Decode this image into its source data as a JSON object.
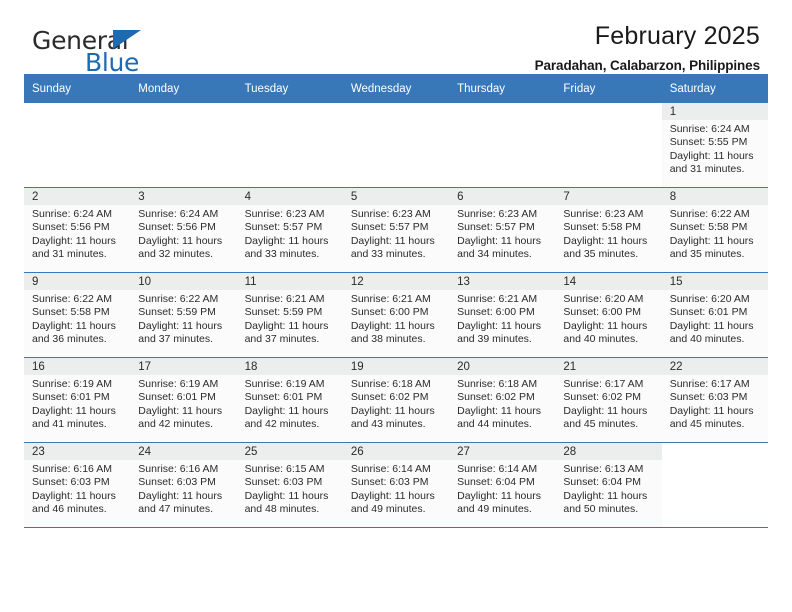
{
  "brand": {
    "line1": "General",
    "line2": "Blue",
    "triangle_color": "#1e69b0"
  },
  "header": {
    "title": "February 2025",
    "subtitle": "Paradahan, Calabarzon, Philippines",
    "accent_color": "#3878b8"
  },
  "calendar": {
    "weekday_headers": [
      "Sunday",
      "Monday",
      "Tuesday",
      "Wednesday",
      "Thursday",
      "Friday",
      "Saturday"
    ],
    "labels": {
      "sunrise": "Sunrise:",
      "sunset": "Sunset:",
      "daylight": "Daylight:"
    },
    "weeks": [
      [
        {
          "empty": true
        },
        {
          "empty": true
        },
        {
          "empty": true
        },
        {
          "empty": true
        },
        {
          "empty": true
        },
        {
          "empty": true
        },
        {
          "day": "1",
          "sunrise": "Sunrise: 6:24 AM",
          "sunset": "Sunset: 5:55 PM",
          "daylight_line1": "Daylight: 11 hours",
          "daylight_line2": "and 31 minutes."
        }
      ],
      [
        {
          "day": "2",
          "sunrise": "Sunrise: 6:24 AM",
          "sunset": "Sunset: 5:56 PM",
          "daylight_line1": "Daylight: 11 hours",
          "daylight_line2": "and 31 minutes."
        },
        {
          "day": "3",
          "sunrise": "Sunrise: 6:24 AM",
          "sunset": "Sunset: 5:56 PM",
          "daylight_line1": "Daylight: 11 hours",
          "daylight_line2": "and 32 minutes."
        },
        {
          "day": "4",
          "sunrise": "Sunrise: 6:23 AM",
          "sunset": "Sunset: 5:57 PM",
          "daylight_line1": "Daylight: 11 hours",
          "daylight_line2": "and 33 minutes."
        },
        {
          "day": "5",
          "sunrise": "Sunrise: 6:23 AM",
          "sunset": "Sunset: 5:57 PM",
          "daylight_line1": "Daylight: 11 hours",
          "daylight_line2": "and 33 minutes."
        },
        {
          "day": "6",
          "sunrise": "Sunrise: 6:23 AM",
          "sunset": "Sunset: 5:57 PM",
          "daylight_line1": "Daylight: 11 hours",
          "daylight_line2": "and 34 minutes."
        },
        {
          "day": "7",
          "sunrise": "Sunrise: 6:23 AM",
          "sunset": "Sunset: 5:58 PM",
          "daylight_line1": "Daylight: 11 hours",
          "daylight_line2": "and 35 minutes."
        },
        {
          "day": "8",
          "sunrise": "Sunrise: 6:22 AM",
          "sunset": "Sunset: 5:58 PM",
          "daylight_line1": "Daylight: 11 hours",
          "daylight_line2": "and 35 minutes."
        }
      ],
      [
        {
          "day": "9",
          "sunrise": "Sunrise: 6:22 AM",
          "sunset": "Sunset: 5:58 PM",
          "daylight_line1": "Daylight: 11 hours",
          "daylight_line2": "and 36 minutes."
        },
        {
          "day": "10",
          "sunrise": "Sunrise: 6:22 AM",
          "sunset": "Sunset: 5:59 PM",
          "daylight_line1": "Daylight: 11 hours",
          "daylight_line2": "and 37 minutes."
        },
        {
          "day": "11",
          "sunrise": "Sunrise: 6:21 AM",
          "sunset": "Sunset: 5:59 PM",
          "daylight_line1": "Daylight: 11 hours",
          "daylight_line2": "and 37 minutes."
        },
        {
          "day": "12",
          "sunrise": "Sunrise: 6:21 AM",
          "sunset": "Sunset: 6:00 PM",
          "daylight_line1": "Daylight: 11 hours",
          "daylight_line2": "and 38 minutes."
        },
        {
          "day": "13",
          "sunrise": "Sunrise: 6:21 AM",
          "sunset": "Sunset: 6:00 PM",
          "daylight_line1": "Daylight: 11 hours",
          "daylight_line2": "and 39 minutes."
        },
        {
          "day": "14",
          "sunrise": "Sunrise: 6:20 AM",
          "sunset": "Sunset: 6:00 PM",
          "daylight_line1": "Daylight: 11 hours",
          "daylight_line2": "and 40 minutes."
        },
        {
          "day": "15",
          "sunrise": "Sunrise: 6:20 AM",
          "sunset": "Sunset: 6:01 PM",
          "daylight_line1": "Daylight: 11 hours",
          "daylight_line2": "and 40 minutes."
        }
      ],
      [
        {
          "day": "16",
          "sunrise": "Sunrise: 6:19 AM",
          "sunset": "Sunset: 6:01 PM",
          "daylight_line1": "Daylight: 11 hours",
          "daylight_line2": "and 41 minutes."
        },
        {
          "day": "17",
          "sunrise": "Sunrise: 6:19 AM",
          "sunset": "Sunset: 6:01 PM",
          "daylight_line1": "Daylight: 11 hours",
          "daylight_line2": "and 42 minutes."
        },
        {
          "day": "18",
          "sunrise": "Sunrise: 6:19 AM",
          "sunset": "Sunset: 6:01 PM",
          "daylight_line1": "Daylight: 11 hours",
          "daylight_line2": "and 42 minutes."
        },
        {
          "day": "19",
          "sunrise": "Sunrise: 6:18 AM",
          "sunset": "Sunset: 6:02 PM",
          "daylight_line1": "Daylight: 11 hours",
          "daylight_line2": "and 43 minutes."
        },
        {
          "day": "20",
          "sunrise": "Sunrise: 6:18 AM",
          "sunset": "Sunset: 6:02 PM",
          "daylight_line1": "Daylight: 11 hours",
          "daylight_line2": "and 44 minutes."
        },
        {
          "day": "21",
          "sunrise": "Sunrise: 6:17 AM",
          "sunset": "Sunset: 6:02 PM",
          "daylight_line1": "Daylight: 11 hours",
          "daylight_line2": "and 45 minutes."
        },
        {
          "day": "22",
          "sunrise": "Sunrise: 6:17 AM",
          "sunset": "Sunset: 6:03 PM",
          "daylight_line1": "Daylight: 11 hours",
          "daylight_line2": "and 45 minutes."
        }
      ],
      [
        {
          "day": "23",
          "sunrise": "Sunrise: 6:16 AM",
          "sunset": "Sunset: 6:03 PM",
          "daylight_line1": "Daylight: 11 hours",
          "daylight_line2": "and 46 minutes."
        },
        {
          "day": "24",
          "sunrise": "Sunrise: 6:16 AM",
          "sunset": "Sunset: 6:03 PM",
          "daylight_line1": "Daylight: 11 hours",
          "daylight_line2": "and 47 minutes."
        },
        {
          "day": "25",
          "sunrise": "Sunrise: 6:15 AM",
          "sunset": "Sunset: 6:03 PM",
          "daylight_line1": "Daylight: 11 hours",
          "daylight_line2": "and 48 minutes."
        },
        {
          "day": "26",
          "sunrise": "Sunrise: 6:14 AM",
          "sunset": "Sunset: 6:03 PM",
          "daylight_line1": "Daylight: 11 hours",
          "daylight_line2": "and 49 minutes."
        },
        {
          "day": "27",
          "sunrise": "Sunrise: 6:14 AM",
          "sunset": "Sunset: 6:04 PM",
          "daylight_line1": "Daylight: 11 hours",
          "daylight_line2": "and 49 minutes."
        },
        {
          "day": "28",
          "sunrise": "Sunrise: 6:13 AM",
          "sunset": "Sunset: 6:04 PM",
          "daylight_line1": "Daylight: 11 hours",
          "daylight_line2": "and 50 minutes."
        },
        {
          "empty": true
        }
      ]
    ]
  }
}
